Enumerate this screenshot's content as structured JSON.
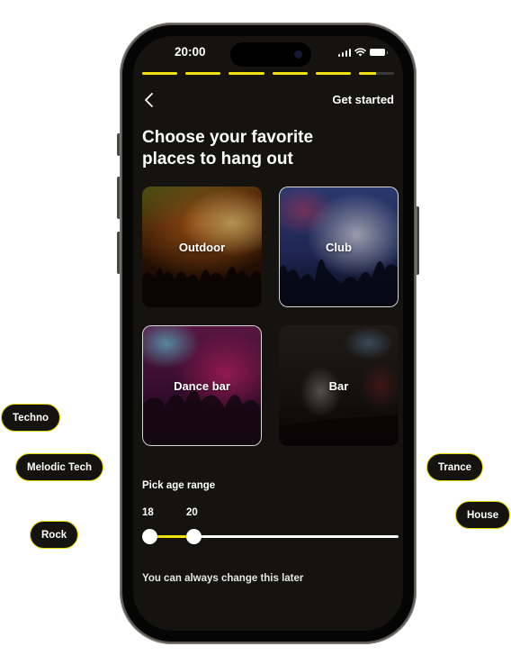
{
  "status_bar": {
    "time": "20:00"
  },
  "progress": {
    "segments": [
      1,
      1,
      1,
      1,
      1,
      0.5
    ],
    "accent": "#f2e20a"
  },
  "header": {
    "back_icon": "chevron-left-icon",
    "action_label": "Get started"
  },
  "title": "Choose your favorite places to hang out",
  "places": [
    {
      "label": "Outdoor",
      "selected": false
    },
    {
      "label": "Club",
      "selected": true
    },
    {
      "label": "Dance bar",
      "selected": true
    },
    {
      "label": "Bar",
      "selected": false
    }
  ],
  "age_range": {
    "label": "Pick age range",
    "min_value": "18",
    "max_value": "20",
    "min": 18,
    "max": 60,
    "selected_min": 18,
    "selected_max": 20
  },
  "hint": "You can always change this later",
  "genre_chips": [
    "Techno",
    "Melodic Tech",
    "Rock",
    "Trance",
    "House"
  ]
}
